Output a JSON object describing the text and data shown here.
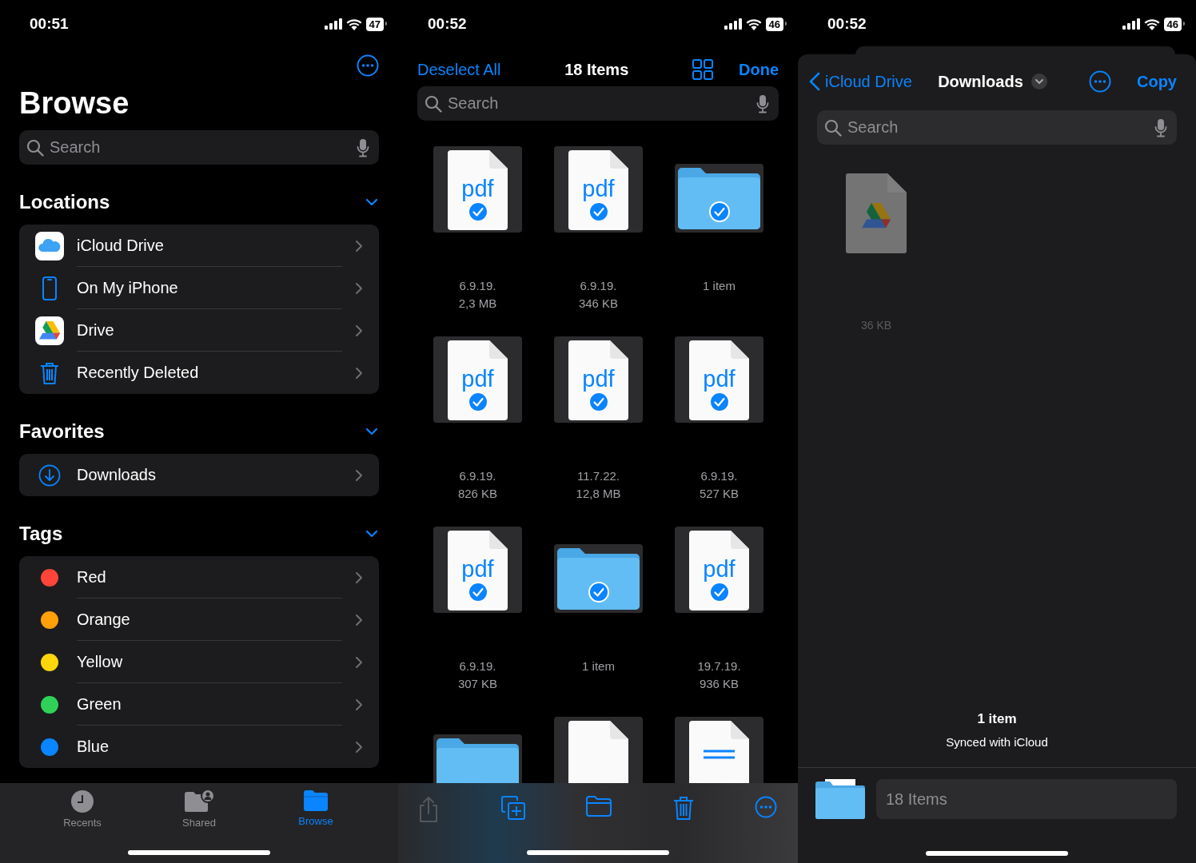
{
  "browse_screen": {
    "status_bar": {
      "time": "00:51",
      "battery": "47"
    },
    "title": "Browse",
    "search": {
      "placeholder": "Search"
    },
    "sections": [
      {
        "title": "Locations",
        "expanded": true,
        "items": [
          {
            "kind": "icloud",
            "label": "iCloud Drive"
          },
          {
            "kind": "phone",
            "label": "On My iPhone"
          },
          {
            "kind": "drive",
            "label": "Drive"
          },
          {
            "kind": "trash",
            "label": "Recently Deleted"
          }
        ]
      },
      {
        "title": "Favorites",
        "expanded": true,
        "items": [
          {
            "kind": "download",
            "label": "Downloads"
          }
        ]
      },
      {
        "title": "Tags",
        "expanded": true,
        "items": [
          {
            "kind": "tag",
            "label": "Red",
            "color": "#ff453a"
          },
          {
            "kind": "tag",
            "label": "Orange",
            "color": "#ff9f0a"
          },
          {
            "kind": "tag",
            "label": "Yellow",
            "color": "#ffd60a"
          },
          {
            "kind": "tag",
            "label": "Green",
            "color": "#30d158"
          },
          {
            "kind": "tag",
            "label": "Blue",
            "color": "#0a84ff"
          }
        ]
      }
    ],
    "tab_bar": [
      {
        "kind": "recents",
        "label": "Recents",
        "selected": false
      },
      {
        "kind": "shared",
        "label": "Shared",
        "selected": false
      },
      {
        "kind": "browse",
        "label": "Browse",
        "selected": true
      }
    ]
  },
  "select_screen": {
    "status_bar": {
      "time": "00:52",
      "battery": "46"
    },
    "nav": {
      "left": "Deselect All",
      "title": "18 Items",
      "right": "Done"
    },
    "search": {
      "placeholder": "Search"
    },
    "files": [
      {
        "kind": "pdf",
        "badge": "pdf",
        "selected": true,
        "line1": "6.9.19.",
        "line2": "2,3 MB"
      },
      {
        "kind": "pdf",
        "badge": "pdf",
        "selected": true,
        "line1": "6.9.19.",
        "line2": "346 KB"
      },
      {
        "kind": "folder",
        "selected": true,
        "line1": "1 item"
      },
      {
        "kind": "pdf",
        "badge": "pdf",
        "selected": true,
        "line1": "6.9.19.",
        "line2": "826 KB"
      },
      {
        "kind": "pdf",
        "badge": "pdf",
        "selected": true,
        "line1": "11.7.22.",
        "line2": "12,8 MB"
      },
      {
        "kind": "pdf",
        "badge": "pdf",
        "selected": true,
        "line1": "6.9.19.",
        "line2": "527 KB"
      },
      {
        "kind": "pdf",
        "badge": "pdf",
        "selected": true,
        "line1": "6.9.19.",
        "line2": "307 KB"
      },
      {
        "kind": "folder",
        "selected": true,
        "line1": "1 item"
      },
      {
        "kind": "pdf",
        "badge": "pdf",
        "selected": true,
        "line1": "19.7.19.",
        "line2": "936 KB"
      },
      {
        "kind": "folder"
      },
      {
        "kind": "pdf"
      },
      {
        "kind": "text"
      }
    ],
    "toolbar": [
      {
        "kind": "share",
        "disabled": true
      },
      {
        "kind": "duplicate",
        "disabled": false
      },
      {
        "kind": "move",
        "disabled": false
      },
      {
        "kind": "delete",
        "disabled": false
      },
      {
        "kind": "more",
        "disabled": false
      }
    ]
  },
  "copy_screen": {
    "status_bar": {
      "time": "00:52",
      "battery": "46"
    },
    "nav": {
      "back": "iCloud Drive",
      "title": "Downloads",
      "action": "Copy"
    },
    "search": {
      "placeholder": "Search"
    },
    "file": {
      "kind": "drive",
      "disabled": true,
      "size": "36 KB"
    },
    "footer": {
      "count": "1 item",
      "sync": "Synced with iCloud"
    },
    "destination": {
      "placeholder": "18 Items"
    }
  }
}
